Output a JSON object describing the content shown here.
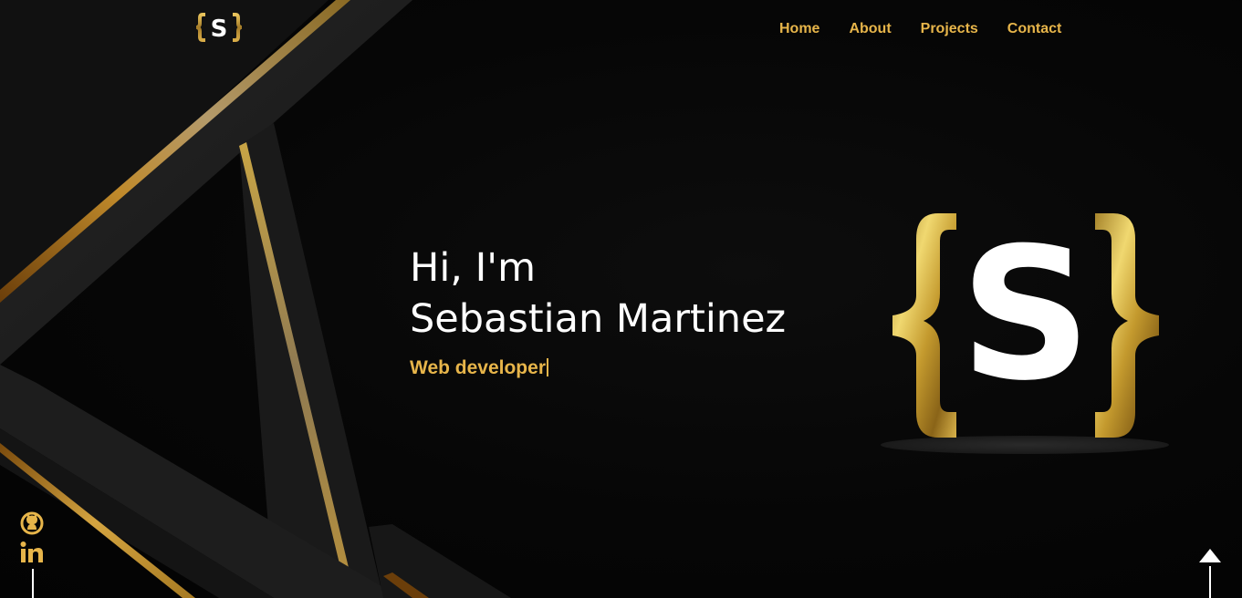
{
  "brand": {
    "logo_letter": "S",
    "logo_left_brace": "{",
    "logo_right_brace": "}"
  },
  "nav": {
    "items": [
      {
        "label": "Home"
      },
      {
        "label": "About"
      },
      {
        "label": "Projects"
      },
      {
        "label": "Contact"
      }
    ]
  },
  "hero": {
    "greeting": "Hi, I'm",
    "name": "Sebastian Martinez",
    "role": "Web developer"
  },
  "social": {
    "items": [
      {
        "icon": "github-icon"
      },
      {
        "icon": "linkedin-icon"
      }
    ]
  },
  "colors": {
    "accent": "#e7b54a",
    "background": "#050505",
    "panel": "#1c1c1c",
    "text": "#ffffff"
  }
}
